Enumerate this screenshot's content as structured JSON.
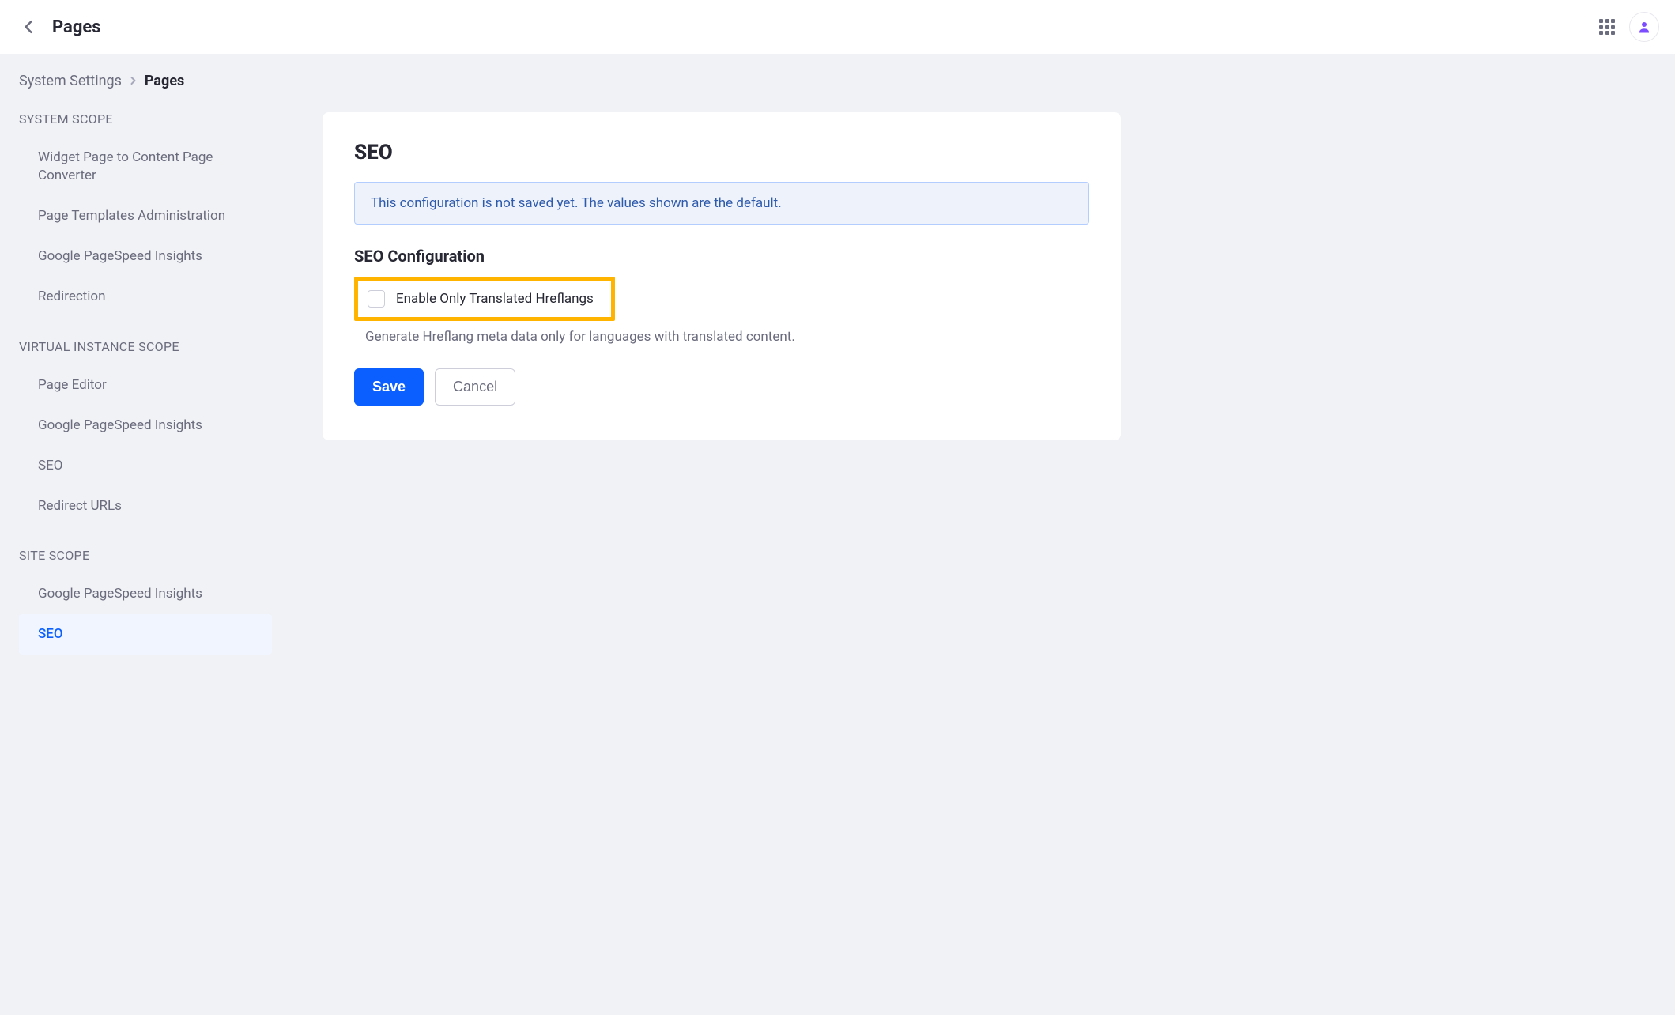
{
  "topbar": {
    "title": "Pages"
  },
  "breadcrumb": {
    "parent": "System Settings",
    "current": "Pages"
  },
  "sidebar": {
    "scopes": [
      {
        "heading": "SYSTEM SCOPE",
        "items": [
          "Widget Page to Content Page Converter",
          "Page Templates Administration",
          "Google PageSpeed Insights",
          "Redirection"
        ]
      },
      {
        "heading": "VIRTUAL INSTANCE SCOPE",
        "items": [
          "Page Editor",
          "Google PageSpeed Insights",
          "SEO",
          "Redirect URLs"
        ]
      },
      {
        "heading": "SITE SCOPE",
        "items": [
          "Google PageSpeed Insights",
          "SEO"
        ]
      }
    ],
    "active_scope": 2,
    "active_index": 1
  },
  "panel": {
    "title": "SEO",
    "alert": "This configuration is not saved yet. The values shown are the default.",
    "section_title": "SEO Configuration",
    "checkbox_label": "Enable Only Translated Hreflangs",
    "help_text": "Generate Hreflang meta data only for languages with translated content.",
    "save": "Save",
    "cancel": "Cancel"
  }
}
